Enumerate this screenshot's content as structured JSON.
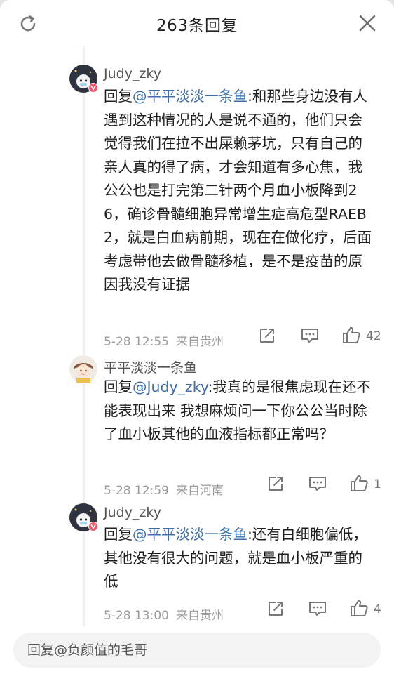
{
  "header": {
    "title": "263条回复"
  },
  "replies": [
    {
      "username": "Judy_zky",
      "reply_prefix": "回复",
      "mention": "@平平淡淡一条鱼",
      "text": ":和那些身边没有人遇到这种情况的人是说不通的，他们只会觉得我们在拉不出屎赖茅坑，只有自己的亲人真的得了病，才会知道有多心焦，我公公也是打完第二针两个月血小板降到26，确诊骨髓细胞异常增生症高危型RAEB2，就是白血病前期，现在在做化疗，后面考虑带他去做骨髓移植，是不是疫苗的原因我没有证据",
      "date": "5-28 12:55",
      "location": "来自贵州",
      "likes": "42"
    },
    {
      "username": "平平淡淡一条鱼",
      "reply_prefix": "回复",
      "mention": "@Judy_zky",
      "text": ":我真的是很焦虑现在还不能表现出来 我想麻烦问一下你公公当时除了血小板其他的血液指标都正常吗？",
      "date": "5-28 12:59",
      "location": "来自河南",
      "likes": "1"
    },
    {
      "username": "Judy_zky",
      "reply_prefix": "回复",
      "mention": "@平平淡淡一条鱼",
      "text": ":还有白细胞偏低，其他没有很大的问题，就是血小板严重的低",
      "date": "5-28 13:00",
      "location": "来自贵州",
      "likes": "4"
    }
  ],
  "composer": {
    "placeholder": "回复@负颜值的毛哥"
  },
  "colors": {
    "mention": "#3d6da6",
    "meta": "#9a9a9a",
    "verified_badge": "#e8596d"
  },
  "icons": [
    "refresh-icon",
    "close-icon",
    "share-icon",
    "comment-icon",
    "like-icon",
    "verified-badge-icon"
  ]
}
